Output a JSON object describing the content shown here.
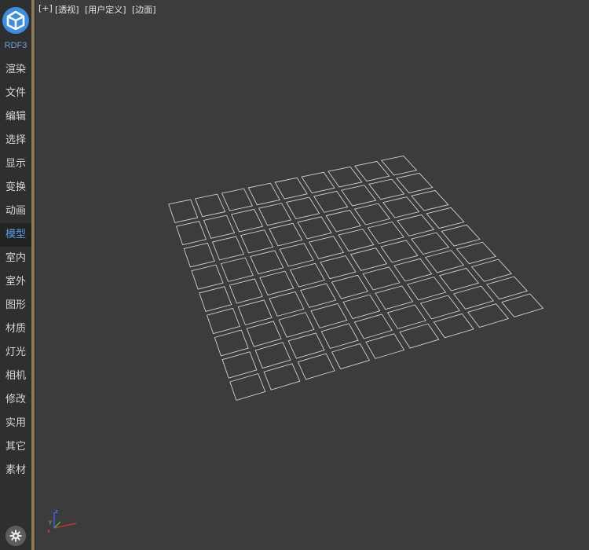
{
  "sidebar": {
    "brand": "RDF3",
    "brand_color": "#3a8ee6",
    "menu": [
      {
        "label": "渲染"
      },
      {
        "label": "文件"
      },
      {
        "label": "编辑"
      },
      {
        "label": "选择"
      },
      {
        "label": "显示"
      },
      {
        "label": "变换"
      },
      {
        "label": "动画"
      },
      {
        "label": "模型",
        "active": true
      },
      {
        "label": "室内"
      },
      {
        "label": "室外"
      },
      {
        "label": "图形"
      },
      {
        "label": "材质"
      },
      {
        "label": "灯光"
      },
      {
        "label": "相机"
      },
      {
        "label": "修改"
      },
      {
        "label": "实用"
      },
      {
        "label": "其它"
      },
      {
        "label": "素材"
      }
    ],
    "settings_icon": "gear-icon"
  },
  "viewport": {
    "labels": [
      "[+]",
      "[透视]",
      "[用户定义]",
      "[边面]"
    ],
    "grid": {
      "rows": 9,
      "cols": 9
    },
    "axis": {
      "z": "z",
      "x": "x",
      "y": "y"
    },
    "colors": {
      "x": "#e03030",
      "y": "#40c040",
      "z": "#4060ff"
    }
  }
}
